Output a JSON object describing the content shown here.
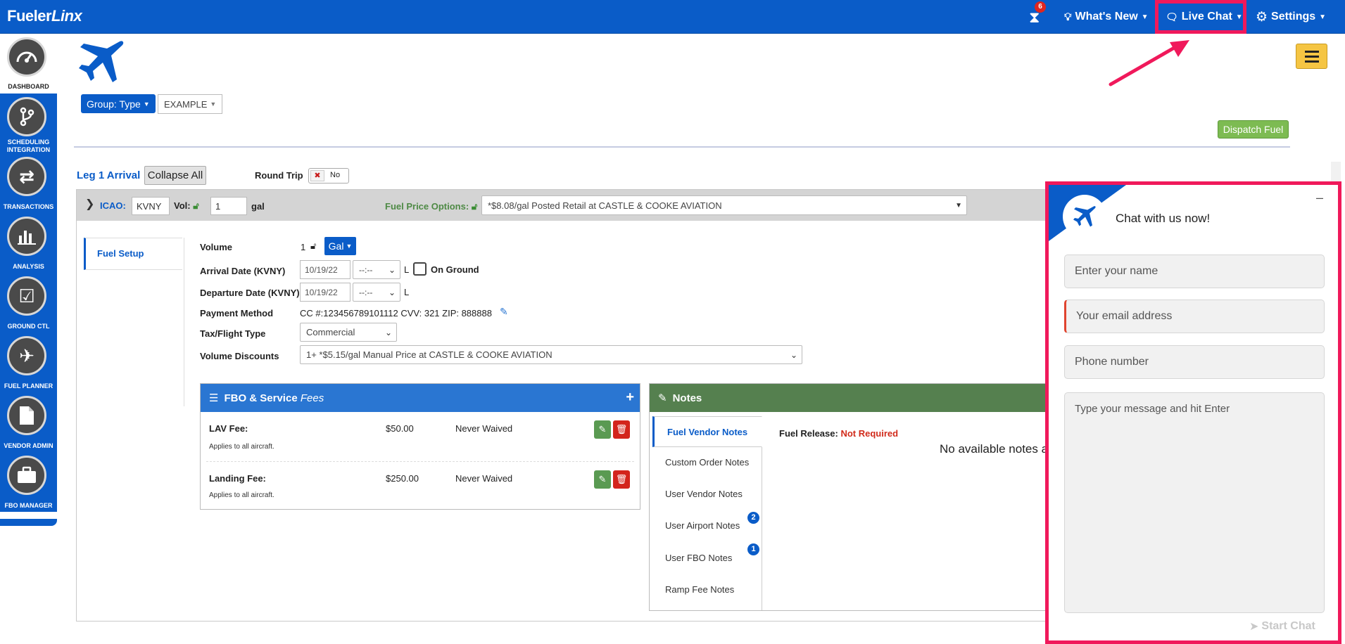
{
  "app": {
    "logo_main": "Fueler",
    "logo_italic": "Linx"
  },
  "topbar": {
    "notification_count": "6",
    "whats_new": "What's New",
    "live_chat": "Live Chat",
    "settings": "Settings"
  },
  "sidebar": {
    "items": [
      {
        "label": "DASHBOARD",
        "icon": "gauge-icon"
      },
      {
        "label": "SCHEDULING INTEGRATION",
        "icon": "branch-icon"
      },
      {
        "label": "TRANSACTIONS",
        "icon": "exchange-icon"
      },
      {
        "label": "ANALYSIS",
        "icon": "bar-chart-icon"
      },
      {
        "label": "GROUND CTL",
        "icon": "checklist-icon"
      },
      {
        "label": "FUEL PLANNER",
        "icon": "plane-icon"
      },
      {
        "label": "VENDOR ADMIN",
        "icon": "document-icon"
      },
      {
        "label": "FBO MANAGER",
        "icon": "briefcase-icon"
      }
    ]
  },
  "toolbar": {
    "group_type": "Group: Type",
    "example": "EXAMPLE",
    "dispatch_fuel": "Dispatch Fuel"
  },
  "leg": {
    "title": "Leg 1 Arrival",
    "collapse_all": "Collapse All",
    "round_trip_label": "Round Trip",
    "round_trip_value": "No",
    "icao_label": "ICAO:",
    "icao_value": "KVNY",
    "vol_label": "Vol:",
    "vol_value": "1",
    "vol_unit": "gal",
    "fuel_price_label": "Fuel Price Options:",
    "fuel_price_value": "*$8.08/gal Posted Retail at CASTLE & COOKE AVIATION"
  },
  "fuel_setup": {
    "tab": "Fuel Setup",
    "volume_label": "Volume",
    "volume_value": "1",
    "unit_button": "Gal",
    "arrival_label": "Arrival Date (KVNY)",
    "arrival_date": "10/19/22",
    "arrival_time": "--:--",
    "arrival_suffix": "L",
    "on_ground": "On Ground",
    "departure_label": "Departure Date (KVNY)",
    "departure_date": "10/19/22",
    "departure_time": "--:--",
    "departure_suffix": "L",
    "payment_label": "Payment Method",
    "payment_value": "CC #:123456789101112 CVV: 321 ZIP: 888888",
    "tax_label": "Tax/Flight Type",
    "tax_value": "Commercial",
    "discounts_label": "Volume Discounts",
    "discounts_value": "1+ *$5.15/gal Manual Price at CASTLE & COOKE AVIATION"
  },
  "fbo": {
    "title": "FBO & Service",
    "title_italic": "Fees",
    "fees": [
      {
        "name": "LAV Fee:",
        "sub": "Applies to all aircraft.",
        "amount": "$50.00",
        "waived": "Never Waived"
      },
      {
        "name": "Landing Fee:",
        "sub": "Applies to all aircraft.",
        "amount": "$250.00",
        "waived": "Never Waived"
      }
    ]
  },
  "notes": {
    "title": "Notes",
    "tabs": [
      {
        "label": "Fuel Vendor Notes",
        "badge": ""
      },
      {
        "label": "Custom Order Notes",
        "badge": ""
      },
      {
        "label": "User Vendor Notes",
        "badge": ""
      },
      {
        "label": "User Airport Notes",
        "badge": "2"
      },
      {
        "label": "User FBO Notes",
        "badge": "1"
      },
      {
        "label": "Ramp Fee Notes",
        "badge": ""
      }
    ],
    "fuel_release_label": "Fuel Release:",
    "fuel_release_value": "Not Required",
    "empty_text": "No available notes a"
  },
  "chat": {
    "title": "Chat with us now!",
    "minimize": "–",
    "name_placeholder": "Enter your name",
    "email_placeholder": "Your email address",
    "phone_placeholder": "Phone number",
    "message_placeholder": "Type your message and hit Enter",
    "start_button": "Start Chat"
  },
  "colors": {
    "brand_blue": "#0a5cc8",
    "highlight_pink": "#f0195b",
    "notes_green": "#55804f",
    "dispatch_green": "#7dbb52",
    "menu_yellow": "#f5c543"
  }
}
